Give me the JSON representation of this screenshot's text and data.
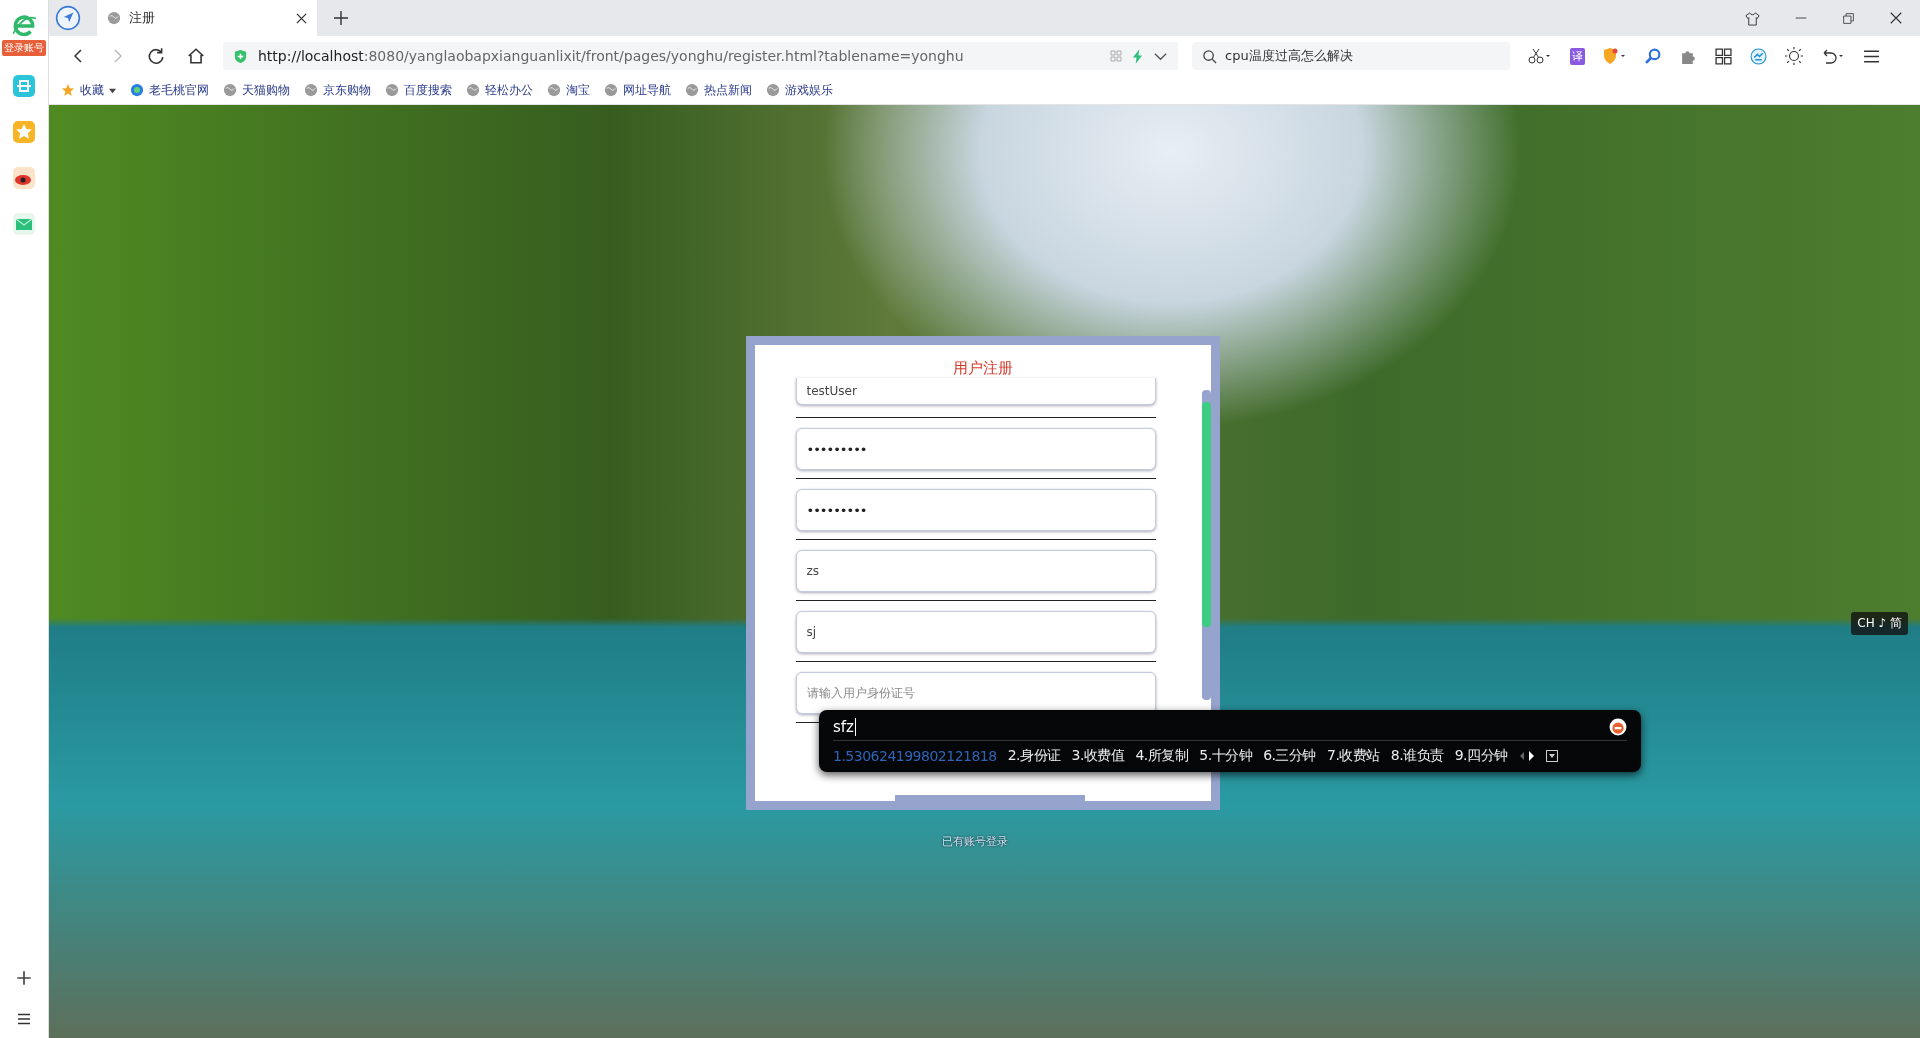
{
  "sidebar": {
    "badge": "登录账号"
  },
  "tabs": [
    {
      "title": "注册",
      "selected": true
    }
  ],
  "address_bar": {
    "url_host": "http://localhost",
    "url_rest": ":8080/yanglaobapxianguanlixit/front/pages/yonghu/register.html?tablename=yonghu"
  },
  "search": {
    "value": "cpu温度过高怎么解决"
  },
  "toolbar": {
    "translate_label": "译"
  },
  "bookmarks": [
    {
      "label": "收藏",
      "kind": "folder"
    },
    {
      "label": "老毛桃官网",
      "kind": "site"
    },
    {
      "label": "天猫购物",
      "kind": "link"
    },
    {
      "label": "京东购物",
      "kind": "link"
    },
    {
      "label": "百度搜索",
      "kind": "link"
    },
    {
      "label": "轻松办公",
      "kind": "link"
    },
    {
      "label": "淘宝",
      "kind": "link"
    },
    {
      "label": "网址导航",
      "kind": "link"
    },
    {
      "label": "热点新闻",
      "kind": "link"
    },
    {
      "label": "游戏娱乐",
      "kind": "link"
    }
  ],
  "form": {
    "title": "用户注册",
    "fields": [
      {
        "kind": "text",
        "value": "testUser"
      },
      {
        "kind": "password",
        "value": "•••••••••"
      },
      {
        "kind": "password",
        "value": "•••••••••"
      },
      {
        "kind": "text",
        "value": "zs"
      },
      {
        "kind": "text",
        "value": "sj"
      },
      {
        "kind": "text",
        "placeholder": "请输入用户身份证号"
      }
    ],
    "login_link": "已有账号登录"
  },
  "ime": {
    "input": "sfz",
    "candidates": [
      {
        "label": "1.530624199802121818",
        "selected": true
      },
      {
        "label": "2.身份证",
        "selected": false
      },
      {
        "label": "3.收费值",
        "selected": false
      },
      {
        "label": "4.所复制",
        "selected": false
      },
      {
        "label": "5.十分钟",
        "selected": false
      },
      {
        "label": "6.三分钟",
        "selected": false
      },
      {
        "label": "7.收费站",
        "selected": false
      },
      {
        "label": "8.谁负责",
        "selected": false
      },
      {
        "label": "9.四分钟",
        "selected": false
      }
    ],
    "mode_indicator": "CH ♪ 简"
  }
}
